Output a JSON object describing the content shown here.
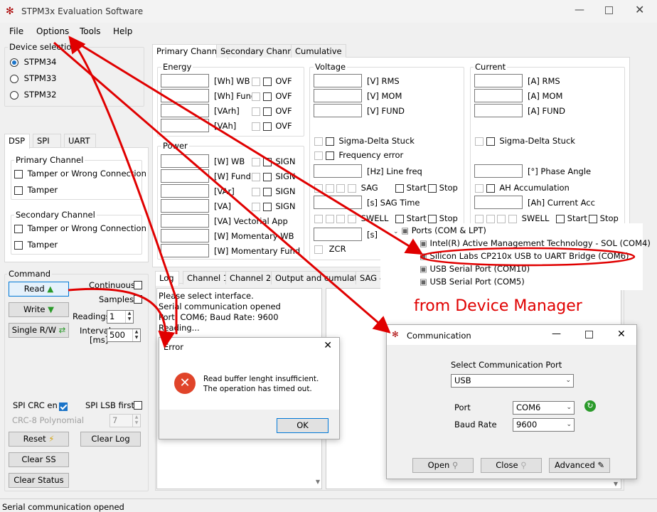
{
  "window": {
    "title": "STPM3x Evaluation Software"
  },
  "menu": [
    "File",
    "Options",
    "Tools",
    "Help"
  ],
  "device_selection": {
    "label": "Device selection",
    "options": [
      "STPM34",
      "STPM33",
      "STPM32"
    ],
    "selected": "STPM34"
  },
  "left_tabs": [
    "DSP",
    "SPI",
    "UART"
  ],
  "dsp": {
    "primary_label": "Primary Channel",
    "secondary_label": "Secondary Channel",
    "tamper_wrong": "Tamper or Wrong Connection",
    "tamper": "Tamper"
  },
  "command": {
    "label": "Command",
    "read": "Read",
    "write": "Write",
    "single": "Single R/W",
    "continuous": "Continuous",
    "samples": "Samples",
    "readings": "Readings",
    "readings_value": "1",
    "interval": "Interval",
    "interval_unit": "[ms]",
    "interval_value": "500",
    "spi_crc": "SPI CRC en",
    "spi_lsb": "SPI LSB first",
    "crc_poly": "CRC-8 Polynomial",
    "crc_value": "7",
    "reset": "Reset",
    "clear_log": "Clear Log",
    "clear_ss": "Clear SS",
    "clear_status": "Clear Status"
  },
  "main_tabs": [
    "Primary Channel",
    "Secondary Channel",
    "Cumulative"
  ],
  "energy": {
    "label": "Energy",
    "rows": [
      "[Wh] WB",
      "[Wh] Fund",
      "[VArh]",
      "[VAh]"
    ],
    "flag": "OVF"
  },
  "power": {
    "label": "Power",
    "rows": [
      "[W] WB",
      "[W] Fund",
      "[VAr]",
      "[VA]",
      "[VA] Vectorial App",
      "[W] Momentary WB",
      "[W] Momentary Fund"
    ],
    "flag": "SIGN"
  },
  "voltage": {
    "label": "Voltage",
    "rows": [
      "[V] RMS",
      "[V] MOM",
      "[V] FUND"
    ],
    "sigma": "Sigma-Delta Stuck",
    "freq_err": "Frequency error",
    "line_freq": "[Hz] Line freq",
    "sag": "SAG",
    "start": "Start",
    "stop": "Stop",
    "sag_time": "[s] SAG Time",
    "swell": "SWELL",
    "swell_time": "[s] S",
    "zcr": "ZCR"
  },
  "current": {
    "label": "Current",
    "rows": [
      "[A] RMS",
      "[A] MOM",
      "[A] FUND"
    ],
    "sigma": "Sigma-Delta Stuck",
    "phase": "[°] Phase Angle",
    "ah_acc": "AH Accumulation",
    "ah_current": "[Ah] Current Acc",
    "swell": "SWELL",
    "start": "Start",
    "stop": "Stop"
  },
  "log_tabs": [
    "Log",
    "Channel 1",
    "Channel 2",
    "Output and cumulative",
    "SAG -"
  ],
  "log_lines": [
    "Please select interface.",
    "Serial communication opened",
    "Port: COM6; Baud Rate: 9600",
    "Reading..."
  ],
  "status_bar": "Serial communication opened",
  "error_dialog": {
    "title": "Error",
    "message1": "Read buffer lenght insufficient.",
    "message2": "The operation has timed out.",
    "ok": "OK"
  },
  "device_manager": {
    "header": "Ports (COM & LPT)",
    "items": [
      "Intel(R) Active Management Technology - SOL (COM4)",
      "Silicon Labs CP210x USB to UART Bridge (COM6)",
      "USB Serial Port (COM10)",
      "USB Serial Port (COM5)"
    ],
    "caption": "from Device Manager"
  },
  "comm_dialog": {
    "title": "Communication",
    "select_label": "Select Communication Port",
    "port_type": "USB",
    "port_label": "Port",
    "port_value": "COM6",
    "baud_label": "Baud Rate",
    "baud_value": "9600",
    "open": "Open",
    "close": "Close",
    "advanced": "Advanced"
  },
  "colors": {
    "annotation": "#e00000",
    "accent": "#1a73c8"
  }
}
